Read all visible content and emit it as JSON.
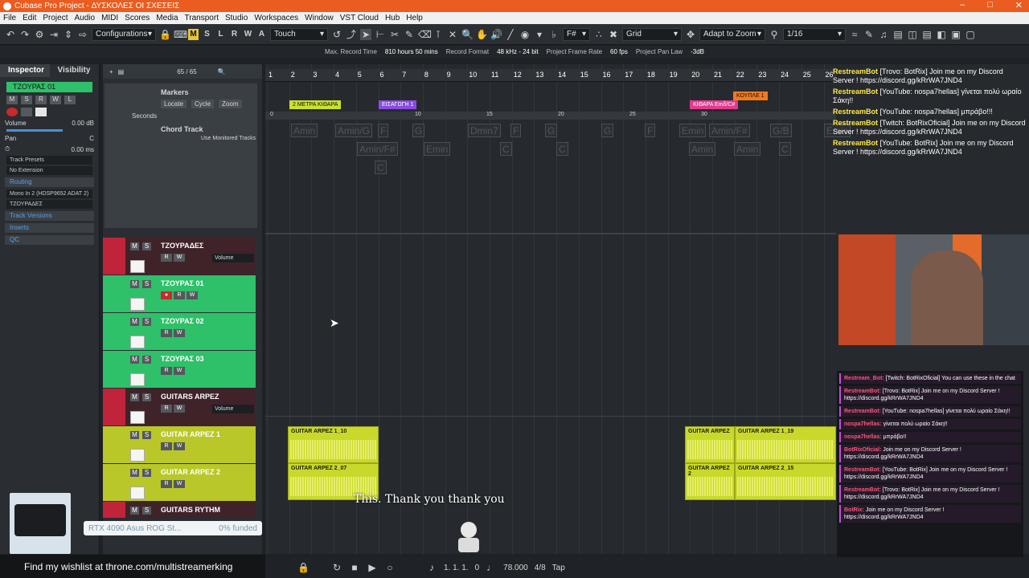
{
  "window": {
    "title": "Cubase Pro Project - ΔΥΣΚΟΛΕΣ ΟΙ ΣΧΕΣΕΙΣ"
  },
  "menu": [
    "File",
    "Edit",
    "Project",
    "Audio",
    "MIDI",
    "Scores",
    "Media",
    "Transport",
    "Studio",
    "Workspaces",
    "Window",
    "VST Cloud",
    "Hub",
    "Help"
  ],
  "toolbar": {
    "configurations": "Configurations",
    "mode_letters": [
      "M",
      "S",
      "L",
      "R",
      "W",
      "A"
    ],
    "touch": "Touch",
    "key": "F#",
    "grid": "Grid",
    "adapt": "Adapt to Zoom",
    "quantize": "1/16"
  },
  "infobar": {
    "max_record_label": "Max. Record Time",
    "max_record_value": "810 hours 50 mins",
    "record_format_label": "Record Format",
    "record_format_value": "48 kHz - 24 bit",
    "frame_rate_label": "Project Frame Rate",
    "frame_rate_value": "60 fps",
    "pan_law_label": "Project Pan Law",
    "pan_law_value": "-3dB"
  },
  "inspector": {
    "tab_inspector": "Inspector",
    "tab_visibility": "Visibility",
    "track_name": "ΤΖΟΥΡΑΣ 01",
    "volume_label": "Volume",
    "volume_value": "0.00 dB",
    "pan_label": "Pan",
    "pan_value": "C",
    "delay_value": "0.00 ms",
    "track_presets": "Track Presets",
    "extension": "No Extension",
    "routing": "Routing",
    "input": "Mono In 2 (HDSP9652 ADAT 2)",
    "output": "ΤΖΟΥΡΑΔΕΣ",
    "track_versions": "Track Versions",
    "inserts": "Inserts",
    "qc": "QC"
  },
  "tracklist": {
    "count": "65 / 65",
    "markers": "Markers",
    "locate": "Locate",
    "cycle": "Cycle",
    "zoom": "Zoom",
    "seconds": "Seconds",
    "chord_track": "Chord Track",
    "use_monitored": "Use Monitored Tracks",
    "tracks": [
      {
        "name": "ΤΖΟΥΡΑΔΕΣ",
        "vol": "Volume"
      },
      {
        "name": "ΤΖΟΥΡΑΣ 01",
        "vol": ""
      },
      {
        "name": "ΤΖΟΥΡΑΣ 02",
        "vol": ""
      },
      {
        "name": "ΤΖΟΥΡΑΣ 03",
        "vol": ""
      },
      {
        "name": "GUITARS ARPEZ",
        "vol": "Volume"
      },
      {
        "name": "GUITAR ARPEZ 1",
        "vol": ""
      },
      {
        "name": "GUITAR ARPEZ 2",
        "vol": ""
      },
      {
        "name": "GUITARS RYTHM",
        "vol": "Volume"
      }
    ]
  },
  "ruler": [
    "1",
    "2",
    "3",
    "4",
    "5",
    "6",
    "7",
    "8",
    "9",
    "10",
    "11",
    "12",
    "13",
    "14",
    "15",
    "16",
    "17",
    "18",
    "19",
    "20",
    "21",
    "22",
    "23",
    "24",
    "25",
    "26"
  ],
  "markers": [
    {
      "label": "2 ΜΕΤΡΑ ΚΙΘΑΡΑ",
      "color": "#c9e22c"
    },
    {
      "label": "ΕΙΣΑΓΩΓΗ 1",
      "color": "#8a4ce0"
    },
    {
      "label": "ΚΙΘΑΡΑ Emδ/C#",
      "color": "#e23a8e"
    },
    {
      "label": "ΚΟΥΠΛΕ 1",
      "color": "#f07a1e"
    }
  ],
  "seconds_ticks": [
    "0",
    "10",
    "15",
    "20",
    "25",
    "30"
  ],
  "chords": [
    "Amin",
    "Amin/G",
    "F",
    "G",
    "Dmin7",
    "F",
    "G",
    "G",
    "F",
    "Emin",
    "Amin/F#",
    "G/B",
    "Emin",
    "Amin/F#",
    "C",
    "Emin",
    "C",
    "C",
    "Amin",
    "Amin",
    "C"
  ],
  "events": [
    "GUITAR ARPEZ 1_10",
    "GUITAR ARPEZ 2_07",
    "GUITAR ARPEZ",
    "GUITAR ARPEZ 1_19",
    "GUITAR ARPEZ 2",
    "GUITAR ARPEZ 2_15"
  ],
  "chat_top": [
    {
      "user": "RestreamBot",
      "text": "[Trovo: BotRix] Join me on my Discord Server ! https://discord.gg/kRrWA7JND4"
    },
    {
      "user": "RestreamBot",
      "text": "[YouTube: nospa7hellas] γίνεται πολύ ωραίο Σάκη!!"
    },
    {
      "user": "RestreamBot",
      "text": "[YouTube: nospa7hellas] μπράβο!!!"
    },
    {
      "user": "RestreamBot",
      "text": "[Twitch: BotRixOficial] Join me on my Discord Server ! https://discord.gg/kRrWA7JND4"
    },
    {
      "user": "RestreamBot",
      "text": "[YouTube: BotRix] Join me on my Discord Server ! https://discord.gg/kRrWA7JND4"
    }
  ],
  "chat_box": [
    {
      "user": "Restream_Bot",
      "text": "[Twitch: BotRixOficial] You can use these in the chat"
    },
    {
      "user": "RestreamBot",
      "text": "[Trovo: BotRix] Join me on my Discord Server ! https://discord.gg/kRrWA7JND4"
    },
    {
      "user": "RestreamBot",
      "text": "[YouTube: nospa7hellas] γίνεται πολύ ωραίο Σάκη!!"
    },
    {
      "user": "nospa7hellas",
      "text": "γίνεται πολύ ωραίο Σάκη!!"
    },
    {
      "user": "nospa7hellas",
      "text": "μπράβο!!"
    },
    {
      "user": "BotRixOficial",
      "text": "Join me on my Discord Server ! https://discord.gg/kRrWA7JND4"
    },
    {
      "user": "RestreamBot",
      "text": "[YouTube: BotRix] Join me on my Discord Server ! https://discord.gg/kRrWA7JND4"
    },
    {
      "user": "RestreamBot",
      "text": "[Trovo: BotRix] Join me on my Discord Server ! https://discord.gg/kRrWA7JND4"
    },
    {
      "user": "BotRix",
      "text": "Join me on my Discord Server ! https://discord.gg/kRrWA7JND4"
    }
  ],
  "transport": {
    "position": "1. 1. 1.",
    "position_end": "0",
    "tempo": "78.000",
    "signature": "4/8",
    "tap": "Tap"
  },
  "overlay": {
    "wishlist": "Find my wishlist at throne.com/multistreamerking",
    "gpu_name": "RTX 4090 Asus ROG St...",
    "funded": "0% funded",
    "subtitle": "This. Thank you thank you"
  },
  "colors": {
    "title_bar": "#ea5c1f",
    "track_red": "#c0243b",
    "track_green": "#2fc06a",
    "track_yellow": "#b9c828"
  }
}
